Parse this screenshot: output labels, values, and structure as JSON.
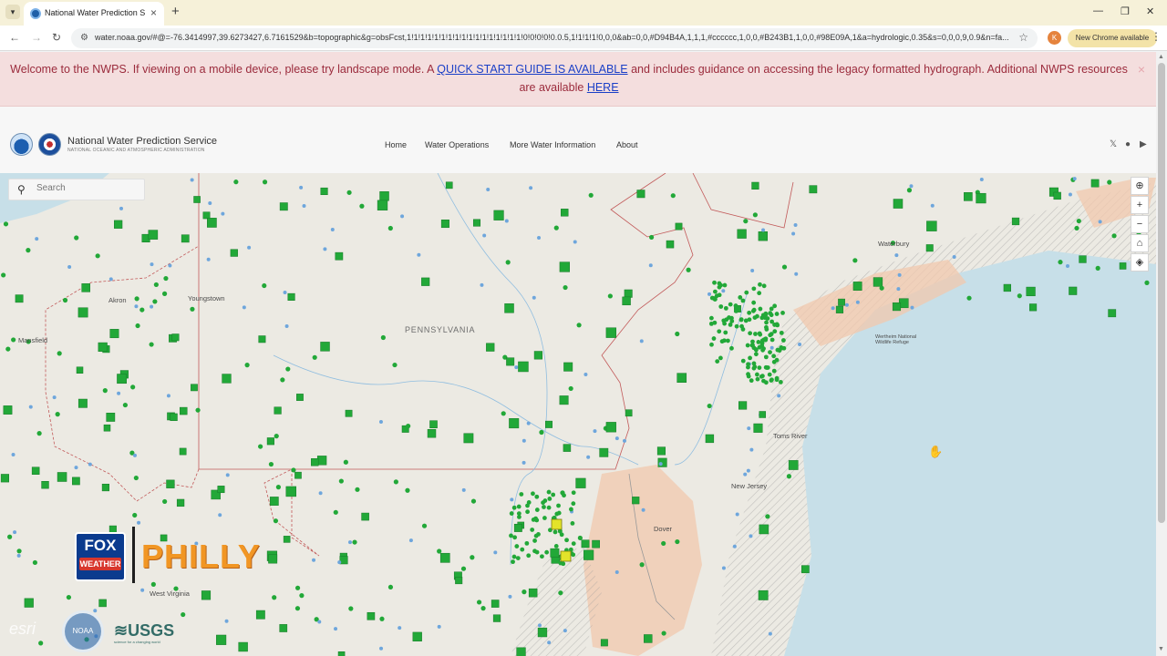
{
  "browser": {
    "tab_title": "National Water Prediction Servi",
    "new_tab": "+",
    "url": "water.noaa.gov/#@=-76.3414997,39.6273427,6.7161529&b=topographic&g=obsFcst,1!1!1!1!1!1!1!1!1!1!1!1!1!1!1!1!1!0!0!0!0!0.0.5,1!1!1!1!0,0,0&ab=0,0,#D94B4A,1,1,1,#cccccc,1,0,0,#B243B1,1,0,0,#98E09A,1&a=hydrologic,0.35&s=0,0,0,9,0.9&n=fa...",
    "profile_initial": "K",
    "update_label": "New Chrome available"
  },
  "banner": {
    "text_before": "Welcome to the NWPS. If viewing on a mobile device, please try landscape mode. A",
    "link_quickstart": "QUICK START GUIDE IS AVAILABLE",
    "text_middle": "and includes guidance on accessing the legacy formatted hydrograph. Additional NWPS resources are available",
    "link_here": "HERE",
    "close": "×"
  },
  "header": {
    "brand_name": "National Water Prediction Service",
    "brand_sub": "NATIONAL OCEANIC AND ATMOSPHERIC ADMINISTRATION",
    "nav": [
      "Home",
      "Water Operations",
      "More Water Information",
      "About"
    ]
  },
  "map": {
    "search_placeholder": "Search",
    "tool_icons": [
      "locate-icon",
      "zoom-in-icon",
      "zoom-out-icon",
      "home-icon",
      "layers-icon"
    ],
    "place_labels": {
      "akron": "Akron",
      "youngstown": "Youngstown",
      "mansfield": "Mansfield",
      "pennsylvania": "PENNSYLVANIA",
      "waterbury": "Waterbury",
      "toms_river": "Toms River",
      "new_jersey": "New Jersey",
      "dover": "Dover",
      "west_virginia": "West Virginia",
      "refuge": "Wertheim National Wildlife Refuge"
    }
  },
  "overlay": {
    "fox_top": "FOX",
    "fox_bottom": "WEATHER",
    "philly": "PHILLY",
    "esri": "esri",
    "noaa": "NOAA",
    "usgs": "≋USGS",
    "usgs_tagline": "science for a changing world"
  },
  "colors": {
    "banner_text": "#9b2b3c",
    "banner_bg": "#f4dede",
    "gauge_green": "#22a838",
    "gauge_blue": "#6ea6dc",
    "gauge_yellow": "#e3e32a",
    "ocean": "#c7dfe8"
  }
}
